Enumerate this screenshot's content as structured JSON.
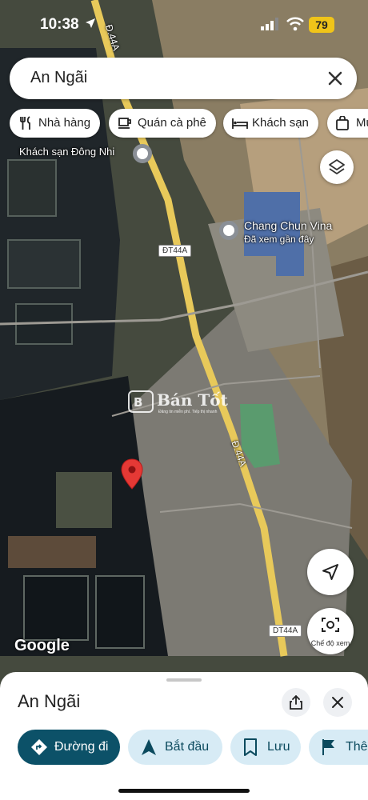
{
  "status_bar": {
    "time": "10:38",
    "battery": "79"
  },
  "search": {
    "query": "An Ngãi"
  },
  "chips": [
    {
      "label": "Nhà hàng",
      "icon": "restaurant-icon"
    },
    {
      "label": "Quán cà phê",
      "icon": "coffee-icon"
    },
    {
      "label": "Khách sạn",
      "icon": "hotel-icon"
    },
    {
      "label": "Mu",
      "icon": "shopping-bag-icon"
    }
  ],
  "map": {
    "labels": {
      "hotel": "Khách sạn Đông Nhi",
      "factory": "Chang Chun Vina",
      "factory_sub": "Đã xem gần đây",
      "road_top": "ĐT44A",
      "road_mid": "ĐT44A",
      "road_vertical": "Đ.44A",
      "road_vertical_top": "Đ.44A",
      "road_bottom": "DT44A"
    },
    "google_logo": "Google",
    "view_mode_label": "Chế độ xem",
    "watermark": "Bán Tốt",
    "watermark_sub": "Đăng tin miễn phí. Tiếp thị nhanh"
  },
  "sheet": {
    "place_name": "An Ngãi",
    "actions": [
      {
        "label": "Đường đi",
        "icon": "directions-icon"
      },
      {
        "label": "Bắt đầu",
        "icon": "navigation-icon"
      },
      {
        "label": "Lưu",
        "icon": "bookmark-icon"
      },
      {
        "label": "Thê",
        "icon": "flag-icon"
      }
    ]
  },
  "colors": {
    "primary_action": "#0c5168",
    "secondary_action": "#d7ebf5",
    "road": "#e8c95a",
    "pin": "#e53935",
    "battery": "#f0c419"
  }
}
